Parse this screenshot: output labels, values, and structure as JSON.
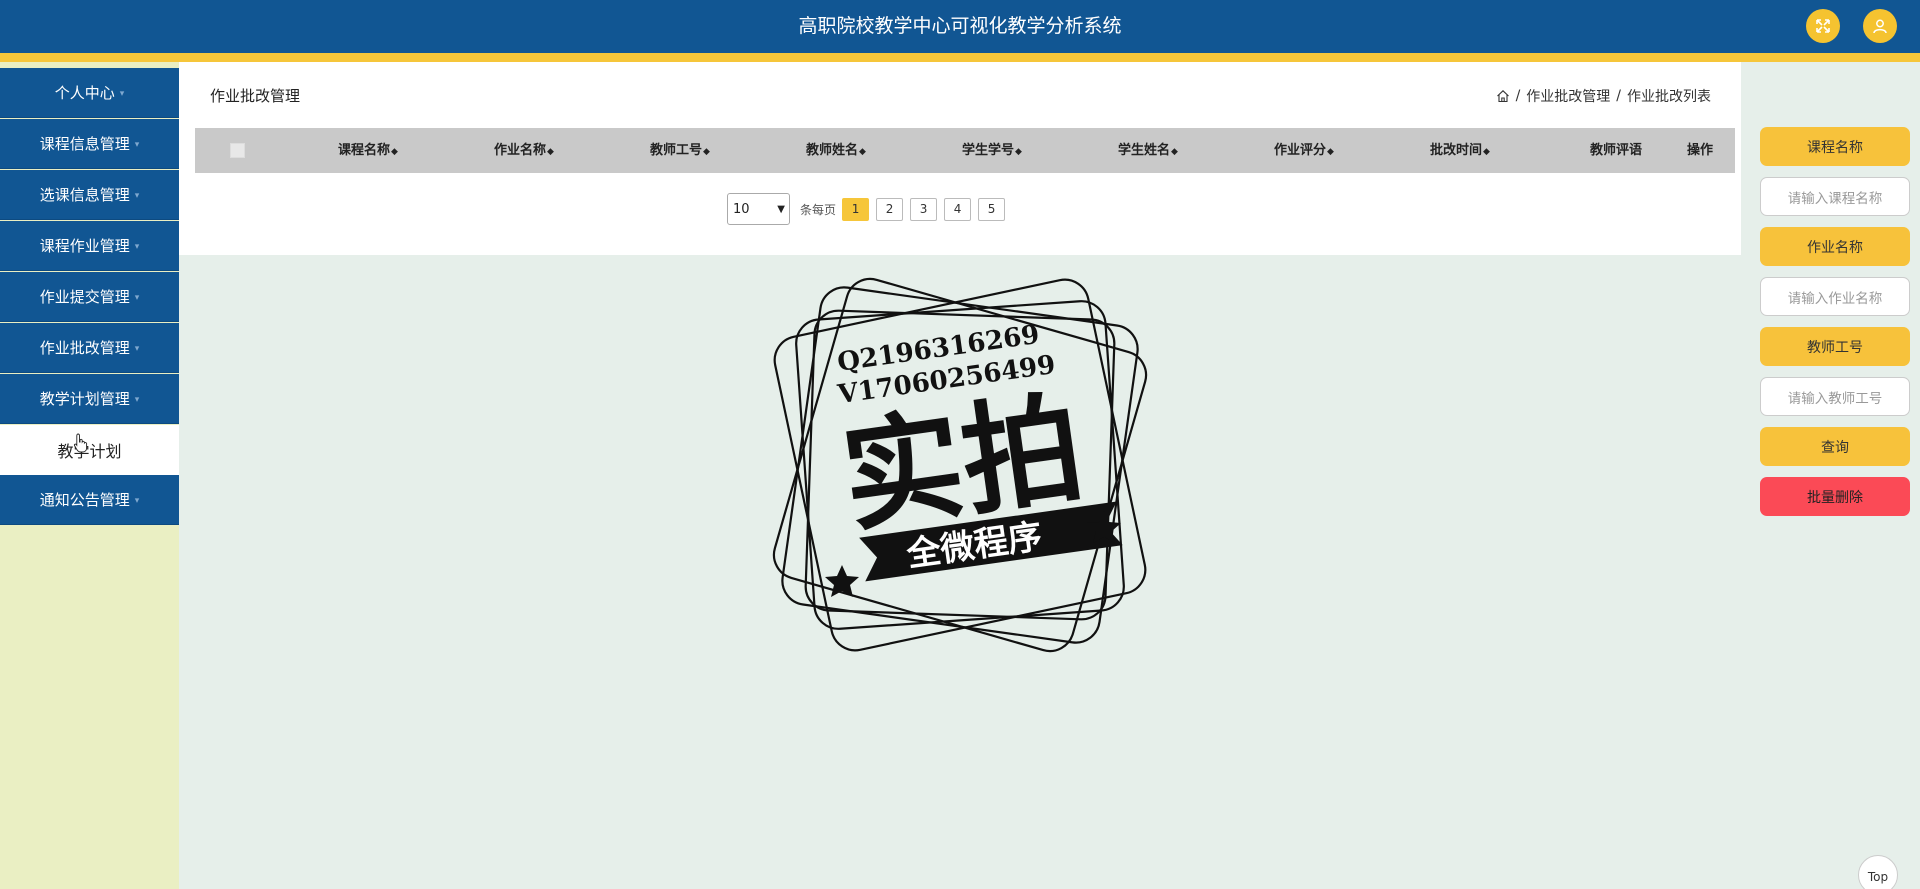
{
  "header": {
    "title": "高职院校教学中心可视化教学分析系统",
    "icons": [
      "fullscreen-icon",
      "user-icon"
    ],
    "colors": {
      "bar": "#115693",
      "accent": "#f6c63a"
    }
  },
  "sidebar": {
    "items": [
      {
        "label": "个人中心"
      },
      {
        "label": "课程信息管理"
      },
      {
        "label": "选课信息管理"
      },
      {
        "label": "课程作业管理"
      },
      {
        "label": "作业提交管理"
      },
      {
        "label": "作业批改管理"
      },
      {
        "label": "教学计划管理"
      },
      {
        "label": "通知公告管理"
      }
    ],
    "sub_item": "教学计划"
  },
  "main": {
    "page_title": "作业批改管理",
    "breadcrumb": [
      "作业批改管理",
      "作业批改列表"
    ],
    "columns": [
      "课程名称",
      "作业名称",
      "教师工号",
      "教师姓名",
      "学生学号",
      "学生姓名",
      "作业评分",
      "批改时间",
      "教师评语",
      "操作"
    ],
    "pager": {
      "page_size": "10",
      "per_page_label": "条每页",
      "pages": [
        "1",
        "2",
        "3",
        "4",
        "5"
      ],
      "current": "1"
    }
  },
  "search": {
    "course_name_label": "课程名称",
    "course_name_placeholder": "请输入课程名称",
    "homework_name_label": "作业名称",
    "homework_name_placeholder": "请输入作业名称",
    "teacher_id_label": "教师工号",
    "teacher_id_placeholder": "请输入教师工号",
    "query_label": "查询",
    "batch_delete_label": "批量删除"
  },
  "stamp": {
    "line1": "Q2196316269",
    "line2": "V17060256499",
    "main": "实拍",
    "ribbon": "全微程序"
  },
  "top_button": "Top"
}
